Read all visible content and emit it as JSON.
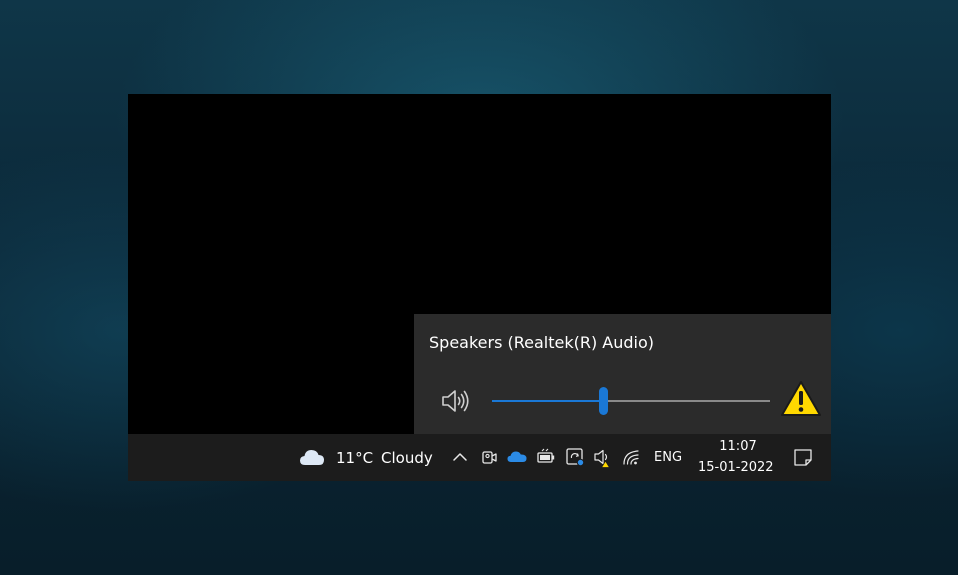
{
  "volume_flyout": {
    "device_name": "Speakers (Realtek(R) Audio)",
    "volume_level_percent": 40,
    "speaker_icon": "speaker-volume-icon",
    "warning_icon": "warning-triangle-icon"
  },
  "taskbar": {
    "weather": {
      "icon": "cloud-icon",
      "temperature": "11°C",
      "condition": "Cloudy"
    },
    "tray_icons": [
      "chevron-up-icon",
      "meet-now-icon",
      "onedrive-cloud-icon",
      "battery-icon",
      "sync-app-icon",
      "speaker-warning-icon",
      "wifi-icon"
    ],
    "language": "ENG",
    "time": "11:07",
    "date": "15-01-2022",
    "notification_icon": "notification-center-icon"
  },
  "colors": {
    "accent": "#1a78d6",
    "warning": "#ffd800",
    "flyout_bg": "#2b2b2b",
    "taskbar_bg": "#1c1c1c"
  }
}
